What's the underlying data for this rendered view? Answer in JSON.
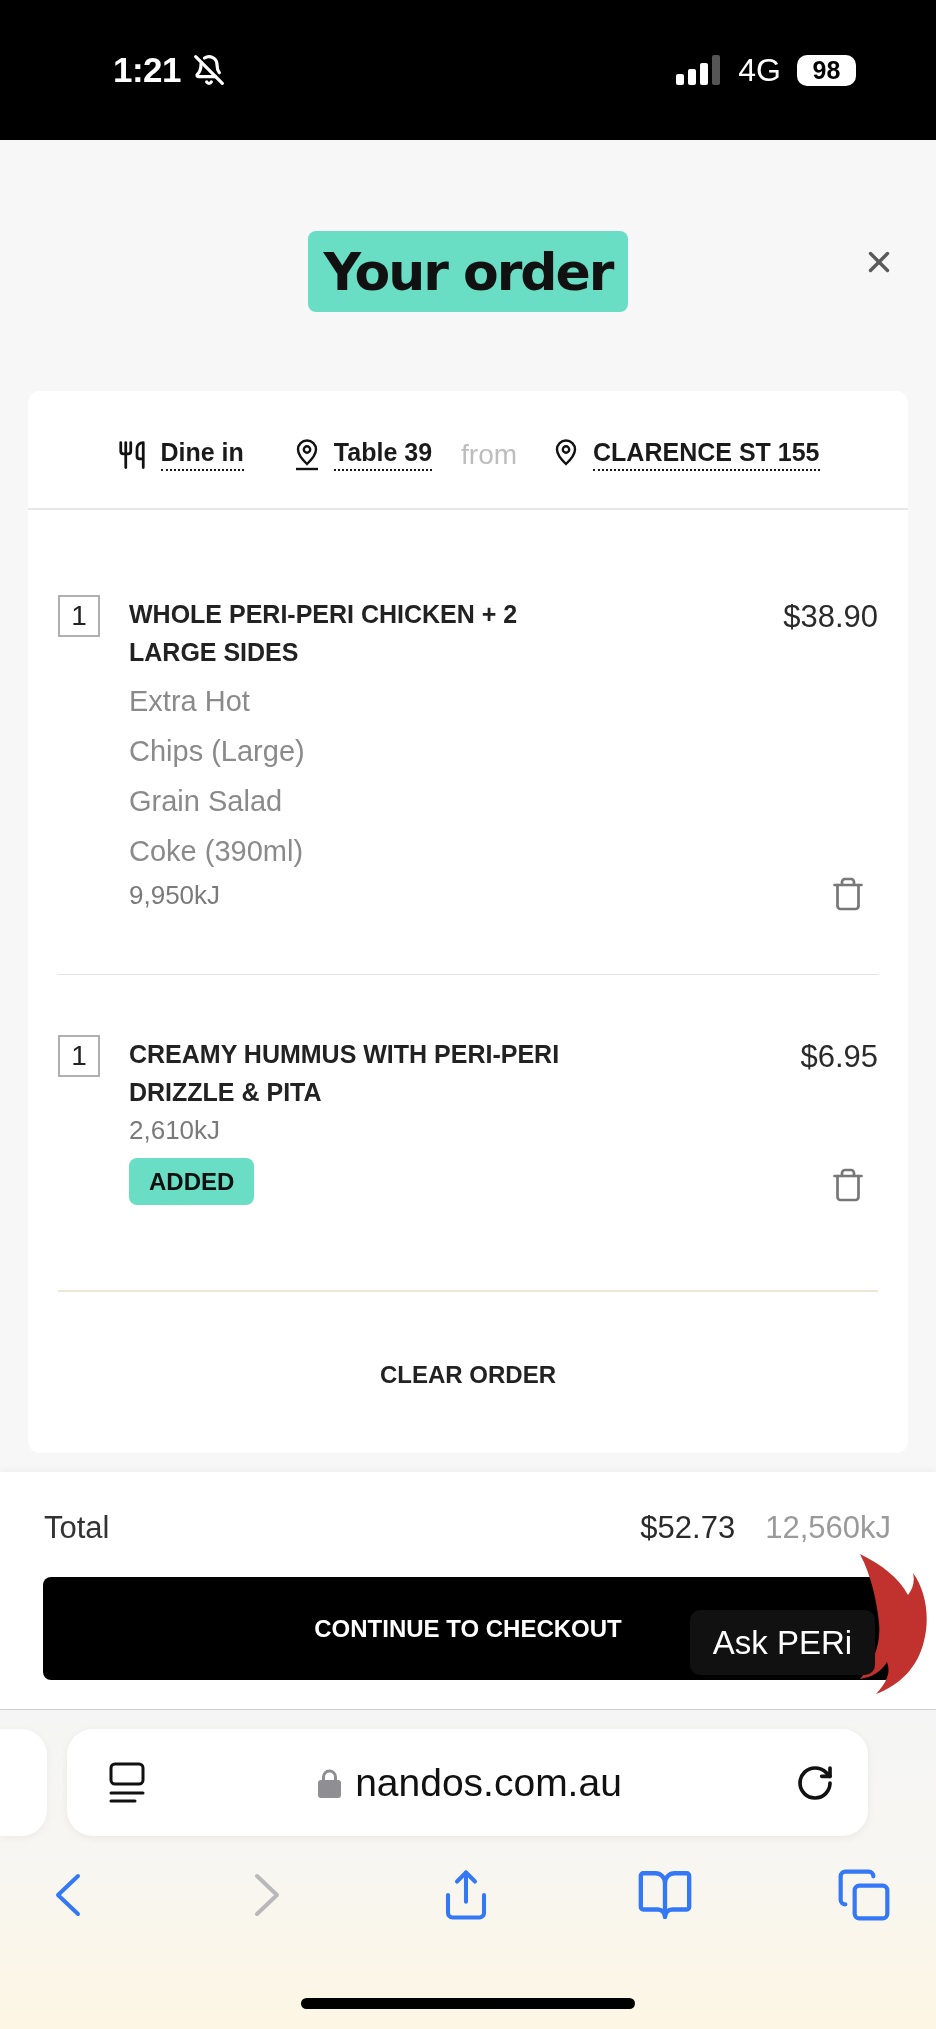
{
  "status_bar": {
    "time": "1:21",
    "silent": true,
    "network": "4G",
    "battery": "98"
  },
  "header": {
    "title": "Your order"
  },
  "order_info": {
    "mode": "Dine in",
    "table": "Table 39",
    "connector": "from",
    "store": "CLARENCE ST 155"
  },
  "items": [
    {
      "quantity": "1",
      "name": "WHOLE PERI-PERI CHICKEN + 2 LARGE SIDES",
      "price": "$38.90",
      "options": [
        "Extra Hot",
        "Chips (Large)",
        "Grain Salad",
        "Coke (390ml)"
      ],
      "energy": "9,950kJ"
    },
    {
      "quantity": "1",
      "name": "CREAMY HUMMUS WITH PERI-PERI DRIZZLE & PITA",
      "price": "$6.95",
      "energy": "2,610kJ",
      "badge": "ADDED"
    }
  ],
  "clear_button": "CLEAR ORDER",
  "summary": {
    "label": "Total",
    "price": "$52.73",
    "energy": "12,560kJ"
  },
  "checkout_button": "CONTINUE TO CHECKOUT",
  "assistant_button": "Ask PERi",
  "browser": {
    "url": "nandos.com.au",
    "back": {
      "disabled": false
    },
    "forward": {
      "disabled": true
    }
  }
}
